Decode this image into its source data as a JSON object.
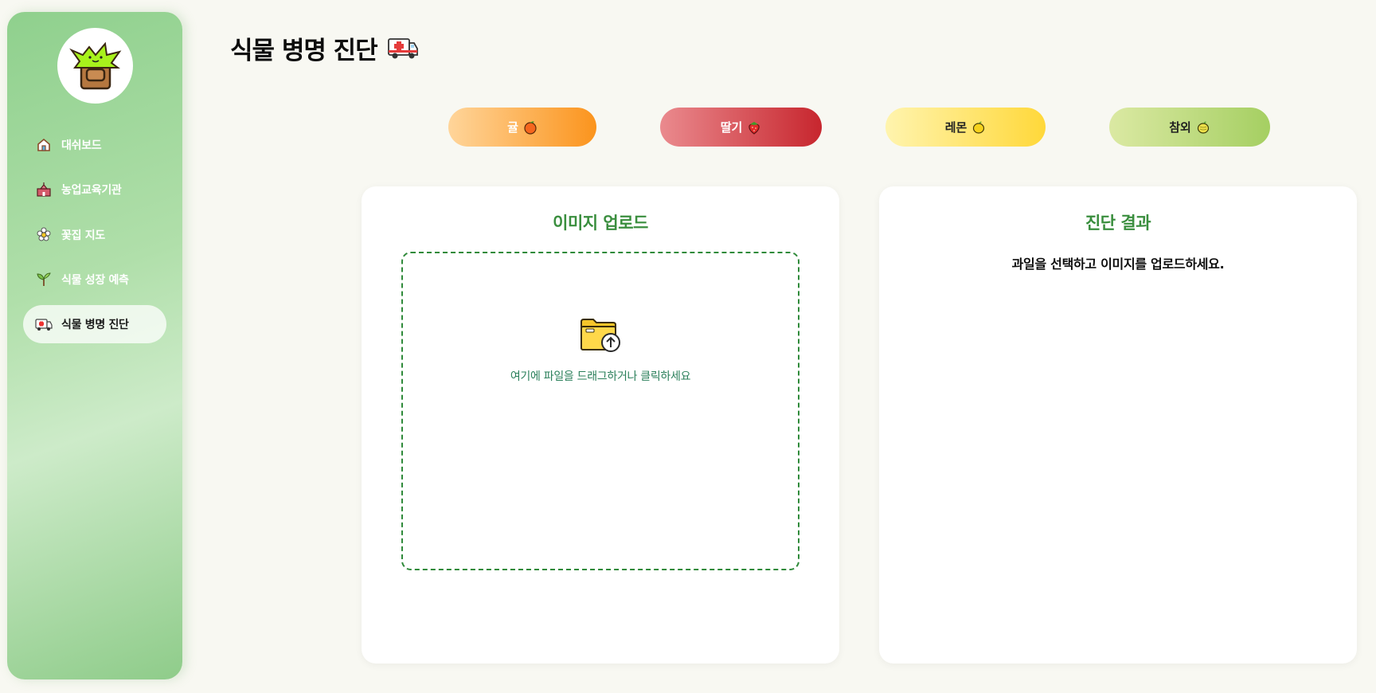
{
  "sidebar": {
    "items": [
      {
        "label": "대쉬보드",
        "icon": "home-icon"
      },
      {
        "label": "농업교육기관",
        "icon": "school-icon"
      },
      {
        "label": "꽃집 지도",
        "icon": "flower-icon"
      },
      {
        "label": "식물 성장 예측",
        "icon": "sprout-icon"
      },
      {
        "label": "식물 병명 진단",
        "icon": "ambulance-icon",
        "active": true
      }
    ]
  },
  "header": {
    "title": "식물 병명 진단",
    "title_icon": "ambulance-icon"
  },
  "fruits": [
    {
      "label": "귤",
      "icon": "tangerine-icon"
    },
    {
      "label": "딸기",
      "icon": "strawberry-icon"
    },
    {
      "label": "레몬",
      "icon": "lemon-icon"
    },
    {
      "label": "참외",
      "icon": "melon-icon"
    }
  ],
  "upload": {
    "title": "이미지 업로드",
    "dropzone_text": "여기에 파일을 드래그하거나 클릭하세요",
    "icon": "folder-upload-icon"
  },
  "result": {
    "title": "진단 결과",
    "message": "과일을 선택하고 이미지를 업로드하세요."
  },
  "colors": {
    "accent_green": "#3a8e3e",
    "tangerine": "#fb941d",
    "strawberry": "#c7262e",
    "lemon": "#ffd83a",
    "melon": "#a5cf62"
  }
}
